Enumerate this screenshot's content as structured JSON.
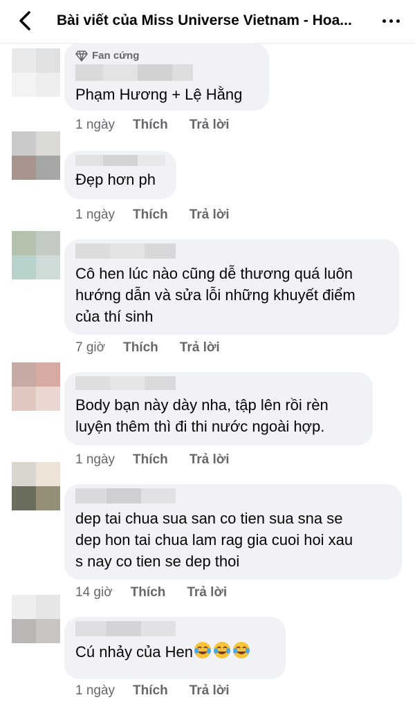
{
  "header": {
    "title": "Bài viết của Miss Universe Vietnam - Hoa...",
    "back_icon": "chevron-left-icon",
    "more_icon": "more-horizontal-icon"
  },
  "comments": [
    {
      "badge": "Fan cứng",
      "text_lines": [
        "Phạm Hương + Lệ Hằng"
      ],
      "time": "1 ngày",
      "like": "Thích",
      "reply": "Trả lời"
    },
    {
      "text_lines": [
        "Đẹp hơn ph"
      ],
      "time": "1 ngày",
      "like": "Thích",
      "reply": "Trả lời"
    },
    {
      "text_lines": [
        "Cô hen lúc nào cũng dễ thương quá luôn",
        "hướng dẫn và sửa lỗi những khuyết điểm",
        "của thí sinh"
      ],
      "time": "7 giờ",
      "like": "Thích",
      "reply": "Trả lời"
    },
    {
      "text_lines": [
        "Body bạn này dày nha, tập lên rồi rèn",
        "luyện thêm thì đi thi nước ngoài hợp."
      ],
      "time": "1 ngày",
      "like": "Thích",
      "reply": "Trả lời"
    },
    {
      "text_lines": [
        "dep tai chua sua san co tien sua sna se",
        "dep hon tai chua lam rag gia cuoi hoi xau",
        "s nay co tien se dep thoi"
      ],
      "time": "14 giờ",
      "like": "Thích",
      "reply": "Trả lời"
    },
    {
      "text_lines": [
        "Cú nhảy của Hen"
      ],
      "emoji_count": 3,
      "emoji_icon": "face-with-tears-of-joy-icon",
      "time": "1 ngày",
      "like": "Thích",
      "reply": "Trả lời"
    }
  ]
}
